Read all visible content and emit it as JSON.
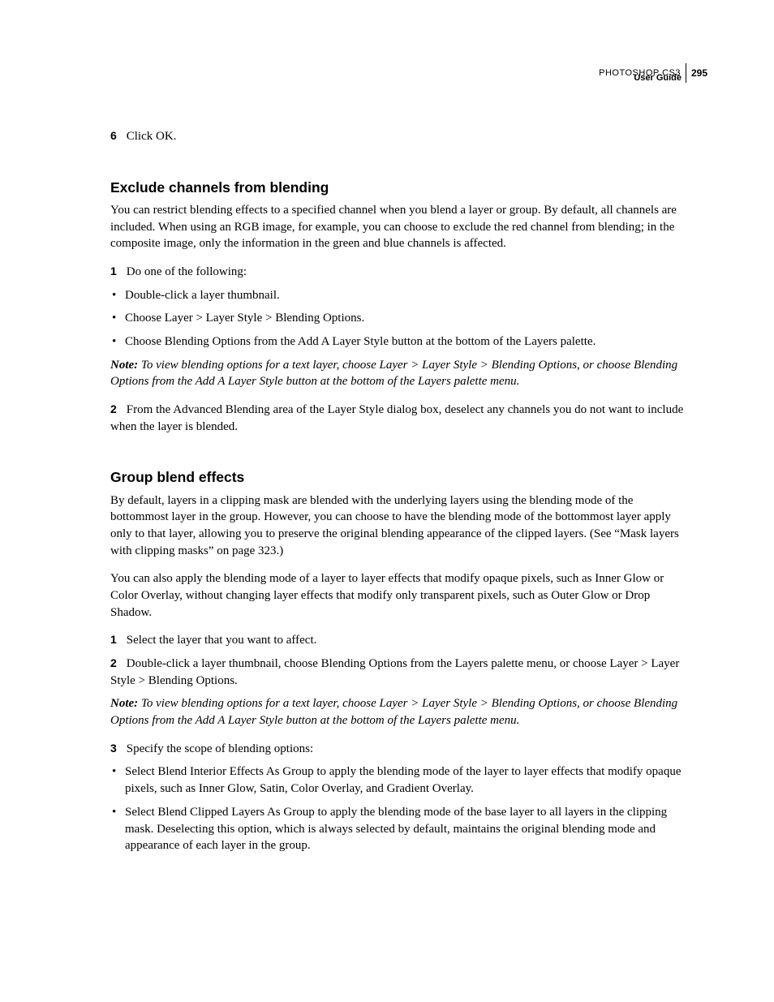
{
  "header": {
    "product": "PHOTOSHOP CS3",
    "guide": "User Guide",
    "page": "295"
  },
  "step6": {
    "num": "6",
    "text": "Click OK."
  },
  "sectionA": {
    "title": "Exclude channels from blending",
    "intro": "You can restrict blending effects to a specified channel when you blend a layer or group. By default, all channels are included. When using an RGB image, for example, you can choose to exclude the red channel from blending; in the composite image, only the information in the green and blue channels is affected.",
    "step1": {
      "num": "1",
      "text": "Do one of the following:"
    },
    "bullets": [
      "Double-click a layer thumbnail.",
      "Choose Layer > Layer Style > Blending Options.",
      "Choose Blending Options from the Add A Layer Style button at the bottom of the Layers palette."
    ],
    "noteLabel": "Note:",
    "note": "To view blending options for a text layer, choose Layer > Layer Style > Blending Options, or choose Blending Options from the Add A Layer Style button at the bottom of the Layers palette menu.",
    "step2": {
      "num": "2",
      "text": "From the Advanced Blending area of the Layer Style dialog box, deselect any channels you do not want to include when the layer is blended."
    }
  },
  "sectionB": {
    "title": "Group blend effects",
    "p1": "By default, layers in a clipping mask are blended with the underlying layers using the blending mode of the bottommost layer in the group. However, you can choose to have the blending mode of the bottommost layer apply only to that layer, allowing you to preserve the original blending appearance of the clipped layers. (See “Mask layers with clipping masks” on page 323.)",
    "p2": "You can also apply the blending mode of a layer to layer effects that modify opaque pixels, such as Inner Glow or Color Overlay, without changing layer effects that modify only transparent pixels, such as Outer Glow or Drop Shadow.",
    "step1": {
      "num": "1",
      "text": "Select the layer that you want to affect."
    },
    "step2": {
      "num": "2",
      "text": "Double-click a layer thumbnail, choose Blending Options from the Layers palette menu, or choose Layer > Layer Style > Blending Options."
    },
    "noteLabel": "Note:",
    "note": "To view blending options for a text layer, choose Layer > Layer Style > Blending Options, or choose Blending Options from the Add A Layer Style button at the bottom of the Layers palette menu.",
    "step3": {
      "num": "3",
      "text": "Specify the scope of blending options:"
    },
    "bullets": [
      "Select Blend Interior Effects As Group to apply the blending mode of the layer to layer effects that modify opaque pixels, such as Inner Glow, Satin, Color Overlay, and Gradient Overlay.",
      "Select Blend Clipped Layers As Group to apply the blending mode of the base layer to all layers in the clipping mask. Deselecting this option, which is always selected by default, maintains the original blending mode and appearance of each layer in the group."
    ]
  }
}
